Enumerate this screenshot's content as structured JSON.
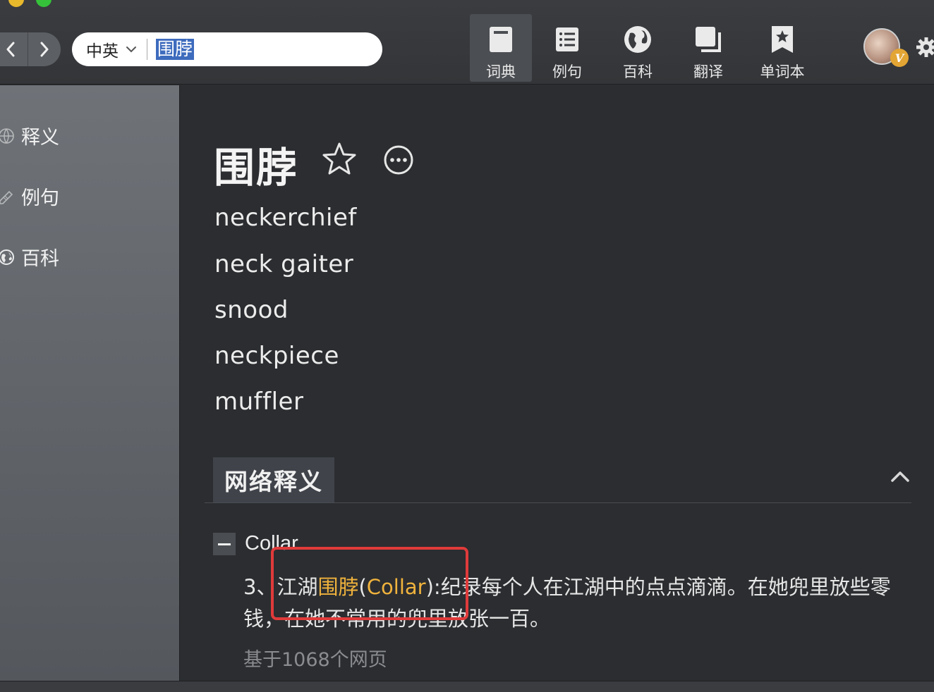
{
  "colors": {
    "accent_highlight": "#f0b33d",
    "annotation_red": "#e03a3a",
    "background": "#2b2d30",
    "sidebar": "#5f6368"
  },
  "nav": {
    "back_icon": "chevron-left-icon",
    "forward_icon": "chevron-right-icon",
    "back_glyph": "‹",
    "forward_glyph": "›"
  },
  "search": {
    "language": "中英",
    "query": "围脖"
  },
  "tabs": [
    {
      "label": "词典",
      "icon": "dictionary-icon"
    },
    {
      "label": "例句",
      "icon": "list-icon"
    },
    {
      "label": "百科",
      "icon": "globe-icon"
    },
    {
      "label": "翻译",
      "icon": "copy-icon"
    },
    {
      "label": "单词本",
      "icon": "bookmark-icon"
    }
  ],
  "user": {
    "vip_badge": "V"
  },
  "sidebar": {
    "items": [
      {
        "label": "释义",
        "icon": "globe-icon"
      },
      {
        "label": "例句",
        "icon": "pen-icon"
      },
      {
        "label": "百科",
        "icon": "globe-icon"
      }
    ]
  },
  "entry": {
    "headword": "围脖",
    "translations": [
      "neckerchief",
      "neck gaiter",
      "snood",
      "neckpiece",
      "muffler"
    ]
  },
  "web_definitions": {
    "section_title": "网络释义",
    "term": "Collar",
    "example": {
      "prefix": "3、江湖",
      "highlight_cn": "围脖",
      "paren_open": "(",
      "highlight_en": "Collar",
      "rest": "):纪录每个人在江湖中的点点滴滴。在她兜里放些零钱，在她不常用的兜里放张一百。"
    },
    "source": "基于1068个网页"
  }
}
